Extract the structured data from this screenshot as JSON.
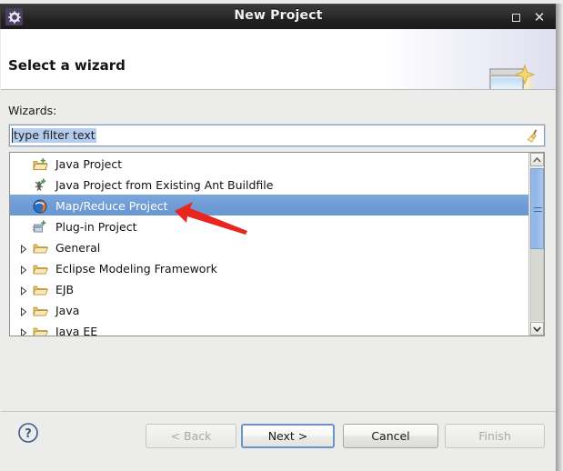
{
  "window": {
    "title": "New Project",
    "app_icon": "gear-icon",
    "controls": {
      "maximize": "□",
      "close": "✕"
    }
  },
  "header": {
    "title": "Select a wizard",
    "graphic": "wizard-sparkle-icon"
  },
  "main": {
    "wizards_label": "Wizards:",
    "filter": {
      "value": "type filter text",
      "placeholder": "type filter text",
      "clear_icon": "broom-icon",
      "selected": true
    },
    "list": [
      {
        "label": "Java Project",
        "icon": "java-project-icon",
        "type": "leaf",
        "selected": false
      },
      {
        "label": "Java Project from Existing Ant Buildfile",
        "icon": "ant-buildfile-icon",
        "type": "leaf",
        "selected": false
      },
      {
        "label": "Map/Reduce Project",
        "icon": "map-reduce-icon",
        "type": "leaf",
        "selected": true
      },
      {
        "label": "Plug-in Project",
        "icon": "plugin-project-icon",
        "type": "leaf",
        "selected": false
      },
      {
        "label": "General",
        "icon": "folder-icon",
        "type": "category",
        "expanded": false
      },
      {
        "label": "Eclipse Modeling Framework",
        "icon": "folder-icon",
        "type": "category",
        "expanded": false
      },
      {
        "label": "EJB",
        "icon": "folder-icon",
        "type": "category",
        "expanded": false
      },
      {
        "label": "Java",
        "icon": "folder-icon",
        "type": "category",
        "expanded": false
      },
      {
        "label": "Java EE",
        "icon": "folder-icon",
        "type": "category",
        "expanded": false
      }
    ],
    "annotation": {
      "type": "red-arrow",
      "points_at": "Map/Reduce Project"
    }
  },
  "footer": {
    "help_icon": "help-question-icon",
    "buttons": [
      {
        "label": "< Back",
        "name": "back-button",
        "state": "disabled"
      },
      {
        "label": "Next >",
        "name": "next-button",
        "state": "default"
      },
      {
        "label": "Cancel",
        "name": "cancel-button",
        "state": "enabled"
      },
      {
        "label": "Finish",
        "name": "finish-button",
        "state": "disabled"
      }
    ]
  },
  "colors": {
    "selection": "#6f9cd6",
    "titlebar": "#2a2a2a",
    "dialog_bg": "#ececeb",
    "accent_red": "#e8251f",
    "filter_selection": "#b4ccf0"
  }
}
